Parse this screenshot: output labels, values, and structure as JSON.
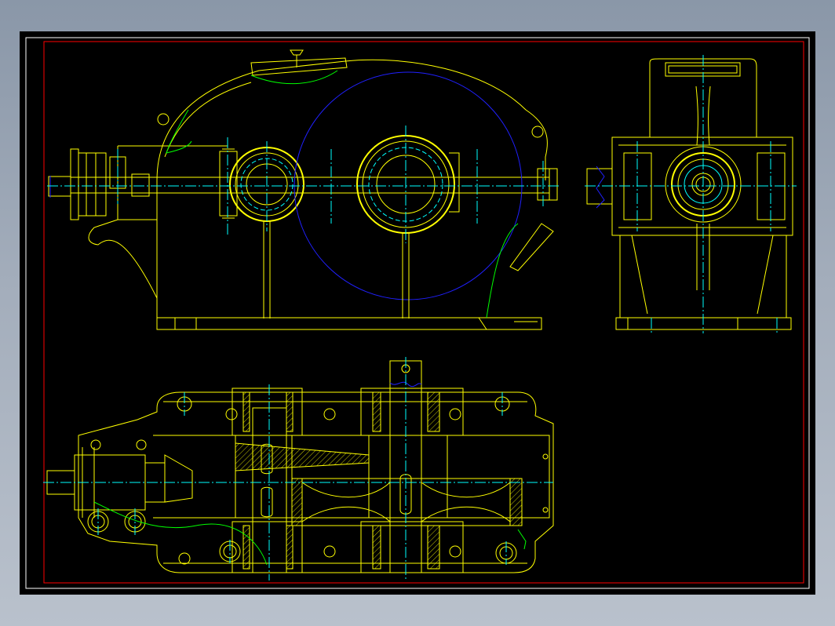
{
  "drawing": {
    "background": "#000000",
    "colors": {
      "outline": "#ffff00",
      "centerline": "#00ffff",
      "break_line": "#00ff00",
      "pitch_circle": "#2020ff",
      "frame": "#ff0000",
      "border": "#ffffff"
    },
    "views": [
      "front-view",
      "side-view",
      "top-section-view"
    ]
  }
}
